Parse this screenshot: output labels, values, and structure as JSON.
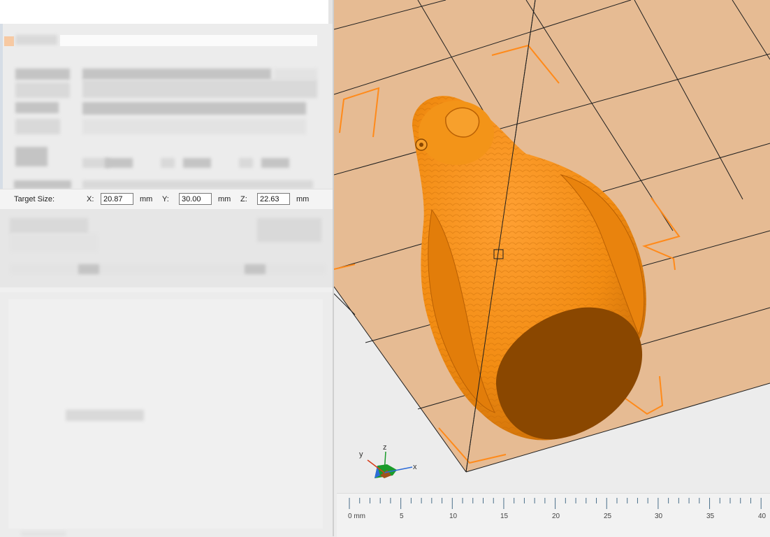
{
  "target_size": {
    "label": "Target Size:",
    "x_label": "X:",
    "x_value": "20.87",
    "y_label": "Y:",
    "y_value": "30.00",
    "z_label": "Z:",
    "z_value": "22.63",
    "unit": "mm"
  },
  "ruler": {
    "labels": [
      "0 mm",
      "5",
      "10",
      "15",
      "20",
      "25",
      "30",
      "35",
      "40"
    ]
  },
  "axis_indicator": {
    "x": "x",
    "y": "y",
    "z": "z"
  },
  "colors": {
    "bed": "#e6bb93",
    "bed_grid": "#1e1e1e",
    "model": "#f28c12",
    "model_dark": "#8a4700",
    "model_shadow": "#c56a06",
    "corner_markers": "#ff8a1a",
    "panel_bg": "#f0f0f0"
  }
}
